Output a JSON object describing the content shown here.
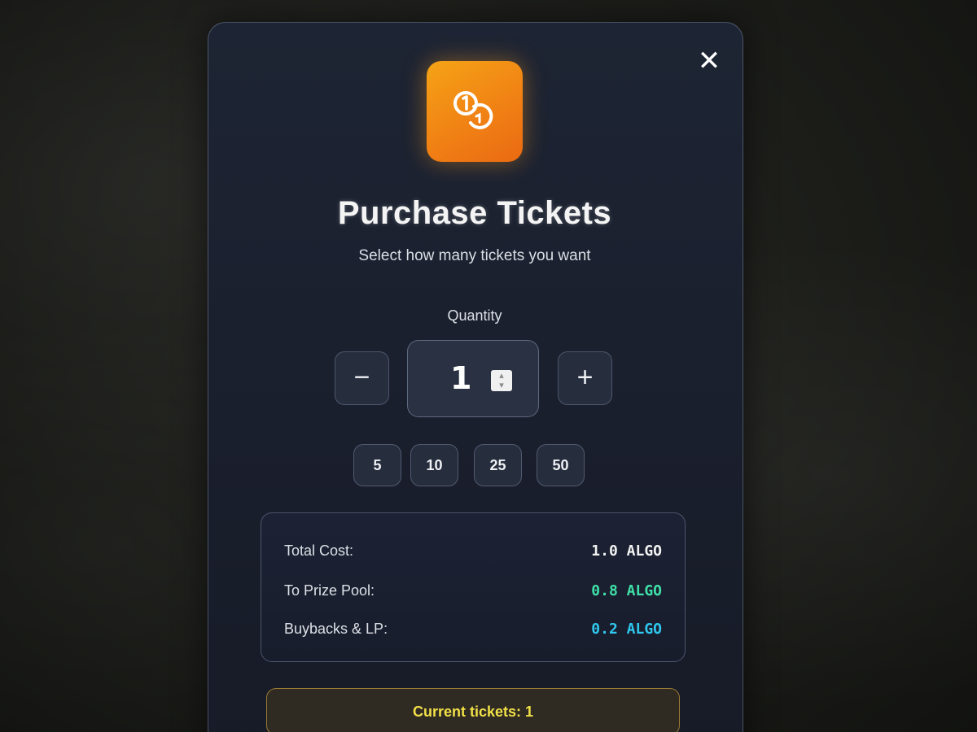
{
  "modal": {
    "close_symbol": "✕",
    "icon_name": "coins-icon",
    "title": "Purchase Tickets",
    "subtitle": "Select how many tickets you want",
    "quantity_label": "Quantity",
    "quantity_value": "1",
    "minus_label": "−",
    "plus_label": "+",
    "presets": [
      "5",
      "10",
      "25",
      "50"
    ],
    "summary": {
      "total_cost_label": "Total Cost:",
      "total_cost_value": "1.0 ALGO",
      "prize_pool_label": "To Prize Pool:",
      "prize_pool_value": "0.8 ALGO",
      "buybacks_label": "Buybacks & LP:",
      "buybacks_value": "0.2 ALGO"
    },
    "current_tickets": "Current tickets: 1"
  },
  "colors": {
    "accent_orange": "#f08a14",
    "prize_pool_green": "#3fe0a8",
    "buybacks_cyan": "#2fc8ee",
    "current_tickets_yellow": "#f1e048"
  }
}
